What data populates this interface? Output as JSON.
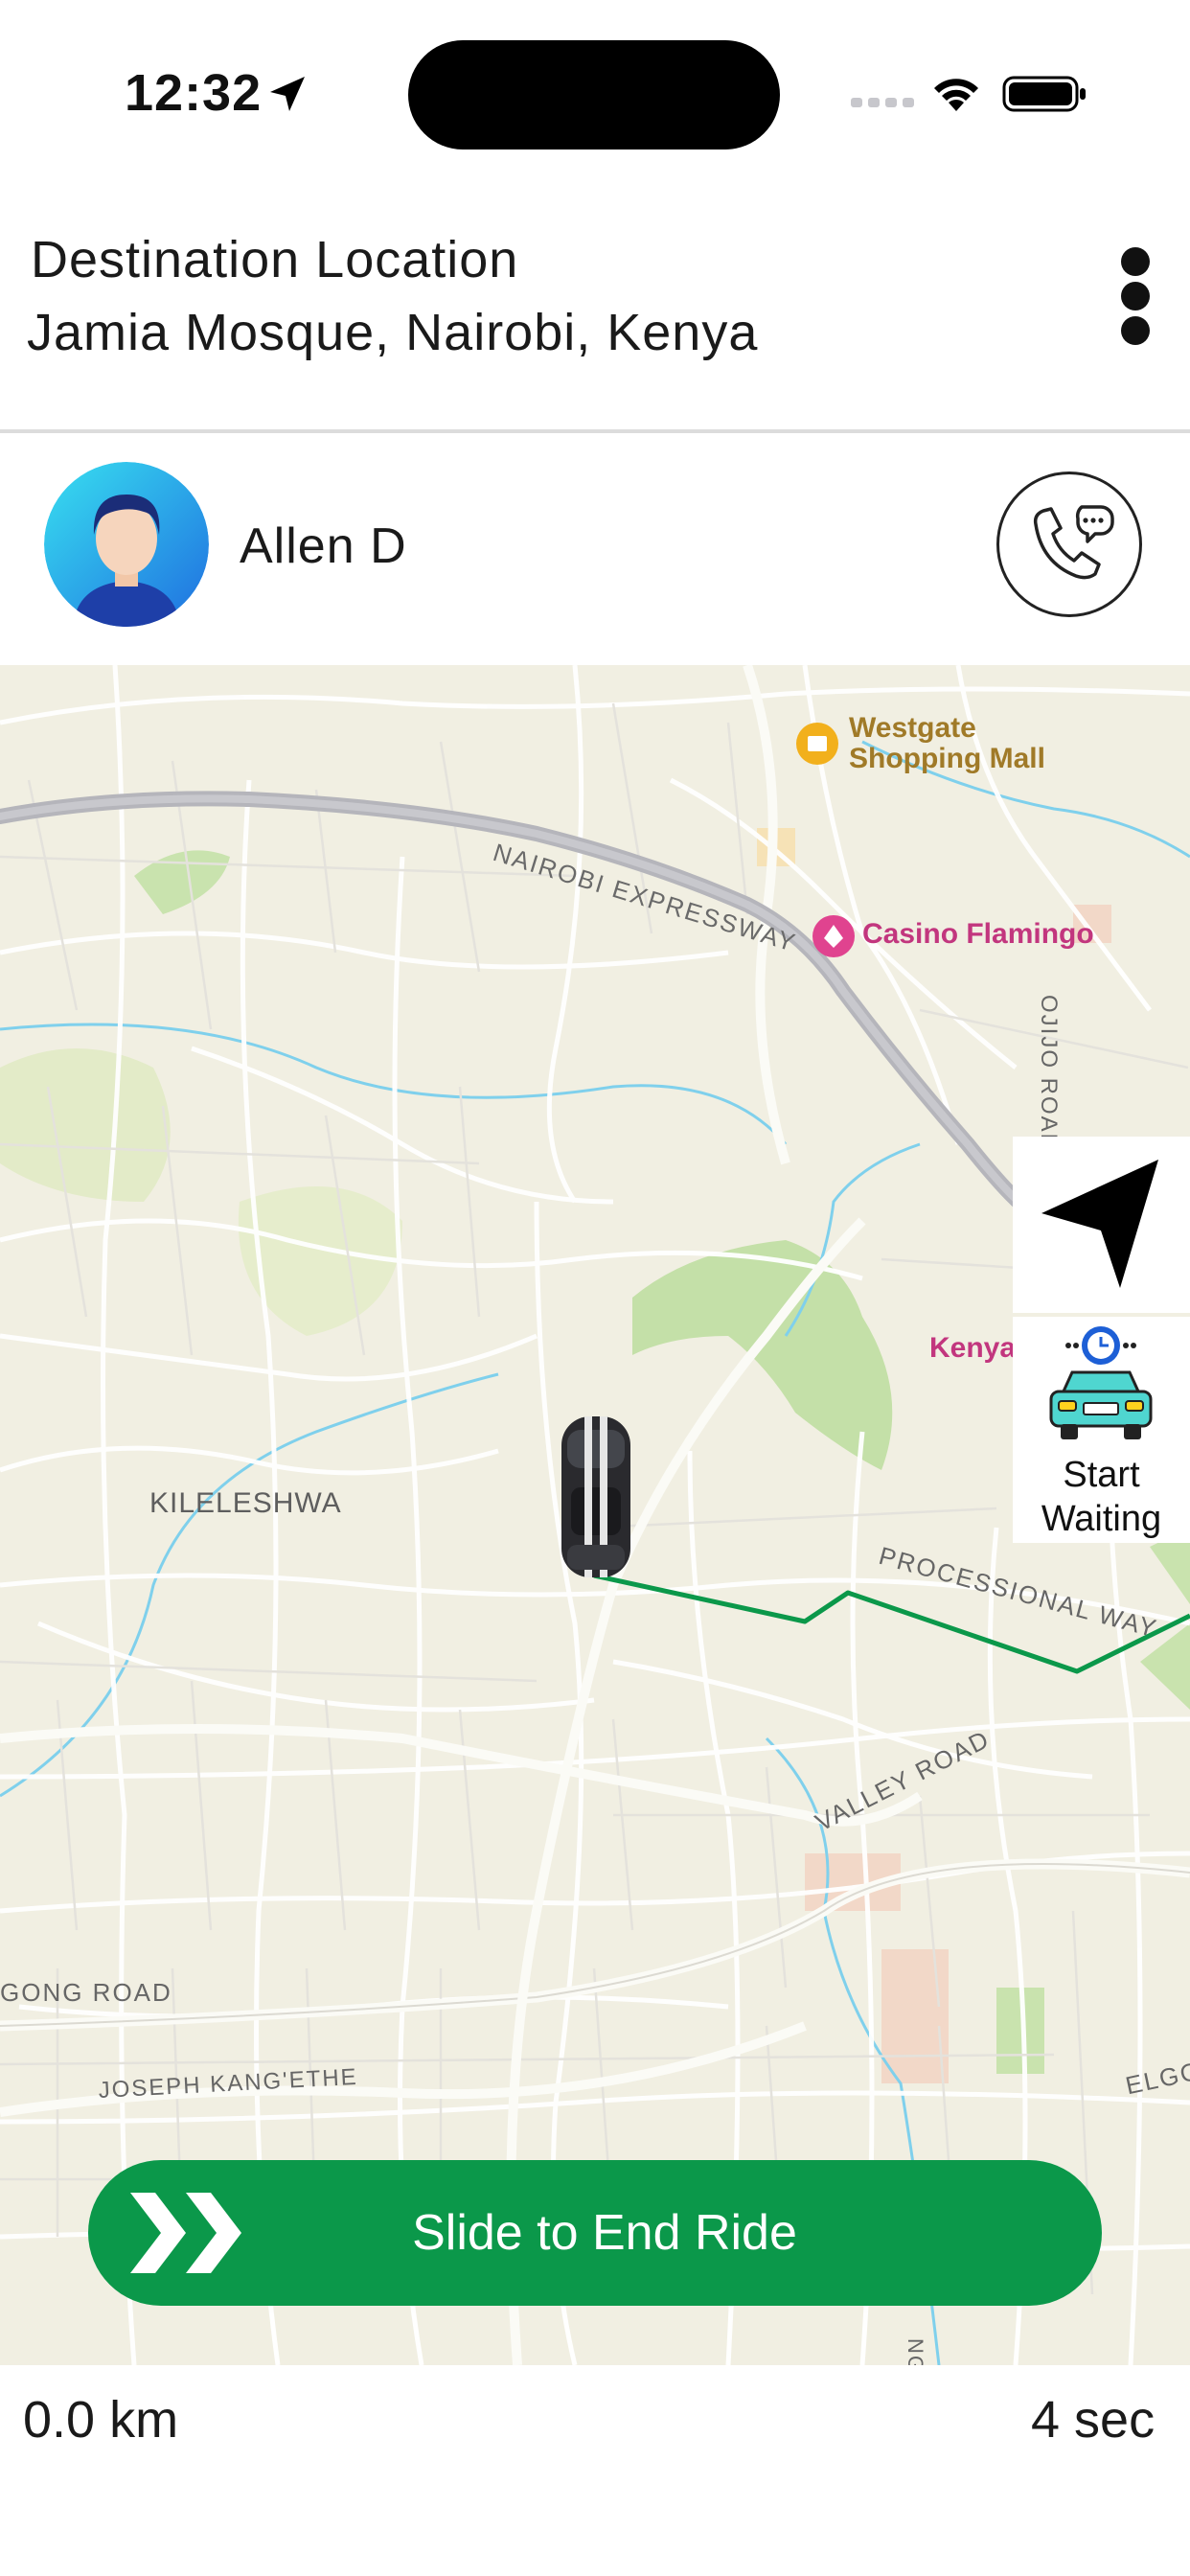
{
  "status_bar": {
    "time": "12:32",
    "icons": [
      "location-arrow-icon",
      "signal-icon",
      "wifi-icon",
      "battery-icon"
    ]
  },
  "header": {
    "caption": "Destination Location",
    "address": "Jamia Mosque, Nairobi, Kenya",
    "menu_icon": "more-vertical-icon"
  },
  "rider": {
    "name": "Allen D",
    "avatar_icon": "user-avatar",
    "contact_icon": "phone-chat-icon"
  },
  "map": {
    "labels": {
      "westgate": "Westgate\nShopping Mall",
      "expressway": "NAIROBI EXPRESSWAY",
      "casino": "Casino Flamingo",
      "ojijo": "OJIJO ROAD",
      "kenya": "Kenya",
      "kileleshwa": "KILELESHWA",
      "processional": "PROCESSIONAL WAY",
      "valley": "VALLEY ROAD",
      "ngong": "GONG ROAD",
      "joseph": "JOSEPH KANG'ETHE",
      "elgon": "ELGO",
      "nga": "NGA"
    },
    "colors": {
      "land": "#f1efe2",
      "park": "#c4e0a8",
      "route": "#0b984a",
      "expressway": "#b5b5bb",
      "water": "#7fd0ec"
    }
  },
  "controls": {
    "recenter_icon": "navigation-arrow-icon",
    "waiting_label": "Start\nWaiting",
    "waiting_icon": "taxi-clock-icon"
  },
  "slider": {
    "label": "Slide to End Ride",
    "icon": "double-chevron-right-icon",
    "color": "#0b984a"
  },
  "trip": {
    "distance": "0.0 km",
    "duration": "4 sec"
  }
}
